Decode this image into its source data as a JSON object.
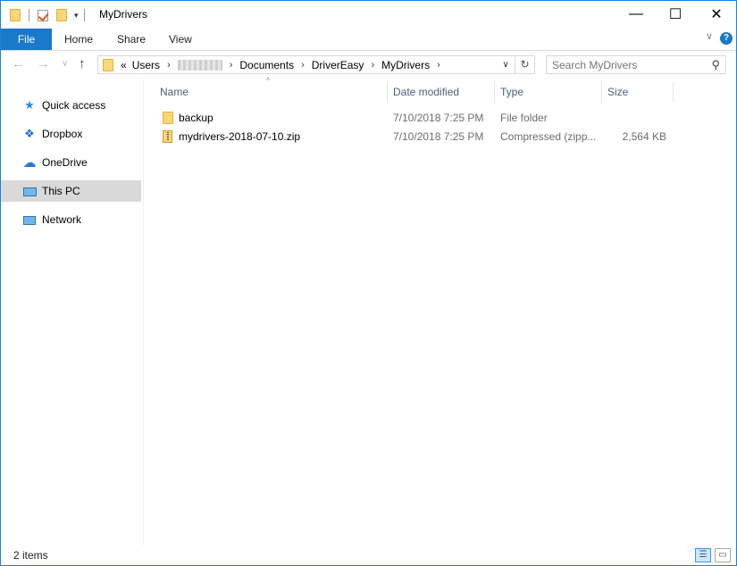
{
  "window": {
    "title": "MyDrivers",
    "minimize_glyph": "—",
    "maximize_glyph": "☐",
    "close_glyph": "✕"
  },
  "ribbon": {
    "tabs": [
      {
        "label": "File"
      },
      {
        "label": "Home"
      },
      {
        "label": "Share"
      },
      {
        "label": "View"
      }
    ],
    "help_glyph": "?",
    "collapse_glyph": "∨"
  },
  "nav": {
    "back_glyph": "←",
    "forward_glyph": "→",
    "recent_glyph": "∨",
    "up_glyph": "↑",
    "overflow_glyph": "«",
    "breadcrumb": [
      "Users",
      "Documents",
      "DriverEasy",
      "MyDrivers"
    ],
    "crumb_sep": "›",
    "dropdown_glyph": "∨",
    "refresh_glyph": "↻"
  },
  "search": {
    "placeholder": "Search MyDrivers"
  },
  "sidebar": {
    "items": [
      {
        "label": "Quick access",
        "icon": "star-icon",
        "glyph": "★",
        "color": "#2b8ad9"
      },
      {
        "label": "Dropbox",
        "icon": "dropbox-icon",
        "glyph": "❖",
        "color": "#1f6ed4"
      },
      {
        "label": "OneDrive",
        "icon": "cloud-icon",
        "glyph": "☁",
        "color": "#1f7ad4"
      },
      {
        "label": "This PC",
        "icon": "monitor-icon",
        "glyph": "🖥",
        "color": "#2b8ad9",
        "selected": true
      },
      {
        "label": "Network",
        "icon": "network-icon",
        "glyph": "🖧",
        "color": "#2b8ad9"
      }
    ]
  },
  "columns": {
    "name": "Name",
    "date": "Date modified",
    "type": "Type",
    "size": "Size",
    "sort_glyph": "^"
  },
  "files": [
    {
      "name": "backup",
      "date": "7/10/2018 7:25 PM",
      "type": "File folder",
      "size": "",
      "icon": "folder-icon"
    },
    {
      "name": "mydrivers-2018-07-10.zip",
      "date": "7/10/2018 7:25 PM",
      "type": "Compressed (zipp...",
      "size": "2,564 KB",
      "icon": "zip-icon"
    }
  ],
  "status": {
    "item_count": "2 items",
    "details_view_glyph": "☰",
    "large_icons_glyph": "▭"
  },
  "colors": {
    "accent": "#1979ca",
    "selection": "#d9d9d9",
    "folder": "#f8d775"
  }
}
